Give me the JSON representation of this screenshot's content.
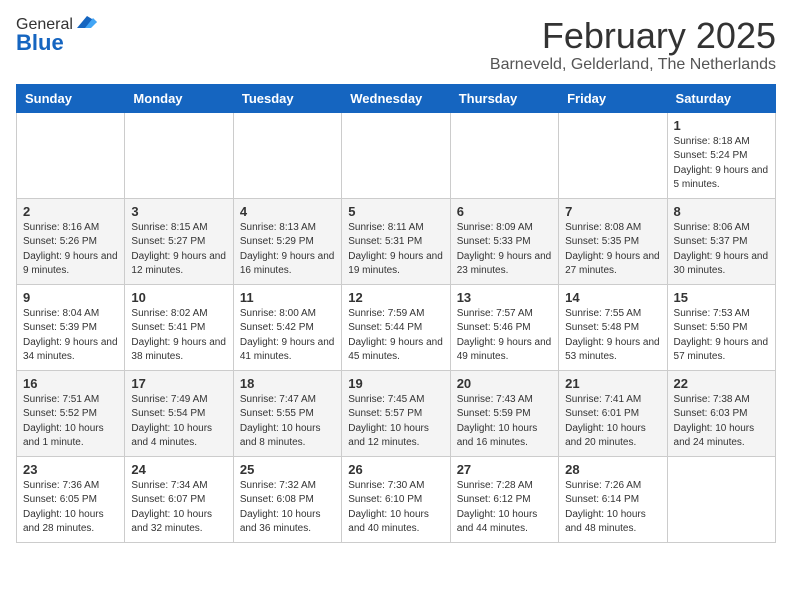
{
  "header": {
    "logo_general": "General",
    "logo_blue": "Blue",
    "month_title": "February 2025",
    "location": "Barneveld, Gelderland, The Netherlands"
  },
  "weekdays": [
    "Sunday",
    "Monday",
    "Tuesday",
    "Wednesday",
    "Thursday",
    "Friday",
    "Saturday"
  ],
  "weeks": [
    [
      {
        "day": "",
        "info": ""
      },
      {
        "day": "",
        "info": ""
      },
      {
        "day": "",
        "info": ""
      },
      {
        "day": "",
        "info": ""
      },
      {
        "day": "",
        "info": ""
      },
      {
        "day": "",
        "info": ""
      },
      {
        "day": "1",
        "info": "Sunrise: 8:18 AM\nSunset: 5:24 PM\nDaylight: 9 hours and 5 minutes."
      }
    ],
    [
      {
        "day": "2",
        "info": "Sunrise: 8:16 AM\nSunset: 5:26 PM\nDaylight: 9 hours and 9 minutes."
      },
      {
        "day": "3",
        "info": "Sunrise: 8:15 AM\nSunset: 5:27 PM\nDaylight: 9 hours and 12 minutes."
      },
      {
        "day": "4",
        "info": "Sunrise: 8:13 AM\nSunset: 5:29 PM\nDaylight: 9 hours and 16 minutes."
      },
      {
        "day": "5",
        "info": "Sunrise: 8:11 AM\nSunset: 5:31 PM\nDaylight: 9 hours and 19 minutes."
      },
      {
        "day": "6",
        "info": "Sunrise: 8:09 AM\nSunset: 5:33 PM\nDaylight: 9 hours and 23 minutes."
      },
      {
        "day": "7",
        "info": "Sunrise: 8:08 AM\nSunset: 5:35 PM\nDaylight: 9 hours and 27 minutes."
      },
      {
        "day": "8",
        "info": "Sunrise: 8:06 AM\nSunset: 5:37 PM\nDaylight: 9 hours and 30 minutes."
      }
    ],
    [
      {
        "day": "9",
        "info": "Sunrise: 8:04 AM\nSunset: 5:39 PM\nDaylight: 9 hours and 34 minutes."
      },
      {
        "day": "10",
        "info": "Sunrise: 8:02 AM\nSunset: 5:41 PM\nDaylight: 9 hours and 38 minutes."
      },
      {
        "day": "11",
        "info": "Sunrise: 8:00 AM\nSunset: 5:42 PM\nDaylight: 9 hours and 41 minutes."
      },
      {
        "day": "12",
        "info": "Sunrise: 7:59 AM\nSunset: 5:44 PM\nDaylight: 9 hours and 45 minutes."
      },
      {
        "day": "13",
        "info": "Sunrise: 7:57 AM\nSunset: 5:46 PM\nDaylight: 9 hours and 49 minutes."
      },
      {
        "day": "14",
        "info": "Sunrise: 7:55 AM\nSunset: 5:48 PM\nDaylight: 9 hours and 53 minutes."
      },
      {
        "day": "15",
        "info": "Sunrise: 7:53 AM\nSunset: 5:50 PM\nDaylight: 9 hours and 57 minutes."
      }
    ],
    [
      {
        "day": "16",
        "info": "Sunrise: 7:51 AM\nSunset: 5:52 PM\nDaylight: 10 hours and 1 minute."
      },
      {
        "day": "17",
        "info": "Sunrise: 7:49 AM\nSunset: 5:54 PM\nDaylight: 10 hours and 4 minutes."
      },
      {
        "day": "18",
        "info": "Sunrise: 7:47 AM\nSunset: 5:55 PM\nDaylight: 10 hours and 8 minutes."
      },
      {
        "day": "19",
        "info": "Sunrise: 7:45 AM\nSunset: 5:57 PM\nDaylight: 10 hours and 12 minutes."
      },
      {
        "day": "20",
        "info": "Sunrise: 7:43 AM\nSunset: 5:59 PM\nDaylight: 10 hours and 16 minutes."
      },
      {
        "day": "21",
        "info": "Sunrise: 7:41 AM\nSunset: 6:01 PM\nDaylight: 10 hours and 20 minutes."
      },
      {
        "day": "22",
        "info": "Sunrise: 7:38 AM\nSunset: 6:03 PM\nDaylight: 10 hours and 24 minutes."
      }
    ],
    [
      {
        "day": "23",
        "info": "Sunrise: 7:36 AM\nSunset: 6:05 PM\nDaylight: 10 hours and 28 minutes."
      },
      {
        "day": "24",
        "info": "Sunrise: 7:34 AM\nSunset: 6:07 PM\nDaylight: 10 hours and 32 minutes."
      },
      {
        "day": "25",
        "info": "Sunrise: 7:32 AM\nSunset: 6:08 PM\nDaylight: 10 hours and 36 minutes."
      },
      {
        "day": "26",
        "info": "Sunrise: 7:30 AM\nSunset: 6:10 PM\nDaylight: 10 hours and 40 minutes."
      },
      {
        "day": "27",
        "info": "Sunrise: 7:28 AM\nSunset: 6:12 PM\nDaylight: 10 hours and 44 minutes."
      },
      {
        "day": "28",
        "info": "Sunrise: 7:26 AM\nSunset: 6:14 PM\nDaylight: 10 hours and 48 minutes."
      },
      {
        "day": "",
        "info": ""
      }
    ]
  ]
}
